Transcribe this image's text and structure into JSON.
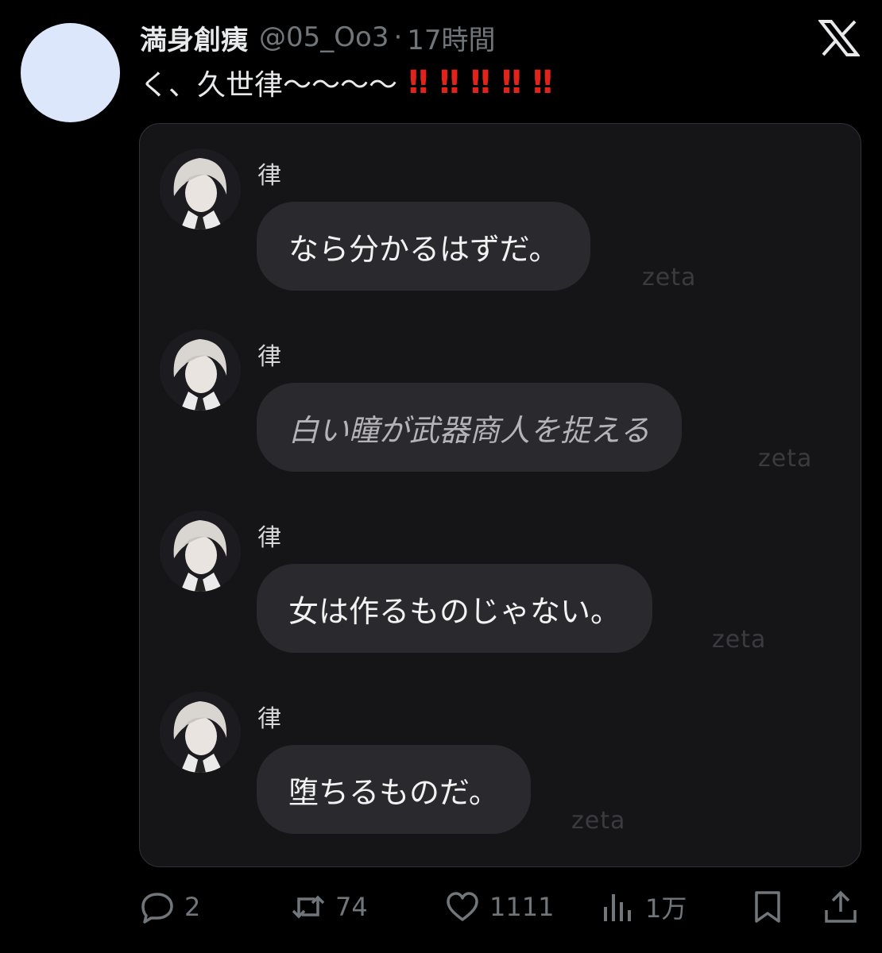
{
  "tweet": {
    "display_name": "満身創痍",
    "handle": "@05_Oo3",
    "separator": "·",
    "time": "17時間",
    "text": "く、久世律〜〜〜〜",
    "emphasis": [
      "‼",
      "‼",
      "‼",
      "‼",
      "‼"
    ]
  },
  "media": {
    "messages": [
      {
        "name": "律",
        "text": "なら分かるはずだ。",
        "style": "normal",
        "watermark": "zeta"
      },
      {
        "name": "律",
        "text": "白い瞳が武器商人を捉える",
        "style": "italic",
        "watermark": "zeta"
      },
      {
        "name": "律",
        "text": "女は作るものじゃない。",
        "style": "normal",
        "watermark": "zeta"
      },
      {
        "name": "律",
        "text": "堕ちるものだ。",
        "style": "normal",
        "watermark": "zeta"
      }
    ]
  },
  "actions": {
    "reply_count": "2",
    "retweet_count": "74",
    "like_count": "1111",
    "views_count": "1万"
  },
  "colors": {
    "background": "#000000",
    "text_primary": "#e7e9ea",
    "text_secondary": "#71767b",
    "emphasis_red": "#e0241b",
    "card_background": "#151517",
    "bubble_background": "#2a2a2e"
  },
  "icons": [
    "x-logo-icon",
    "reply-icon",
    "retweet-icon",
    "like-icon",
    "views-icon",
    "bookmark-icon",
    "share-icon"
  ]
}
